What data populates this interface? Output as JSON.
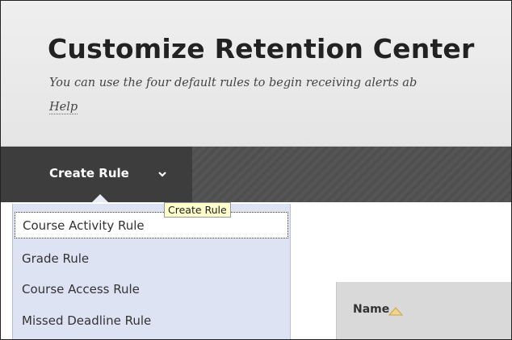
{
  "header": {
    "title": "Customize Retention Center",
    "subtitle": "You can use the four default rules to begin receiving alerts ab",
    "help_link": "Help"
  },
  "toolbar": {
    "create_rule_label": "Create Rule"
  },
  "tooltip": {
    "text": "Create Rule"
  },
  "menu": {
    "items": [
      {
        "label": "Course Activity Rule"
      },
      {
        "label": "Grade Rule"
      },
      {
        "label": "Course Access Rule"
      },
      {
        "label": "Missed Deadline Rule"
      }
    ]
  },
  "table": {
    "column_name": "Name"
  },
  "icons": {
    "dropdown": "chevron-down-icon",
    "sort": "sort-ascending-icon"
  },
  "colors": {
    "toolbar_bg": "#555555",
    "menu_bg": "#dde3f3",
    "tooltip_bg": "#ffffcc"
  }
}
